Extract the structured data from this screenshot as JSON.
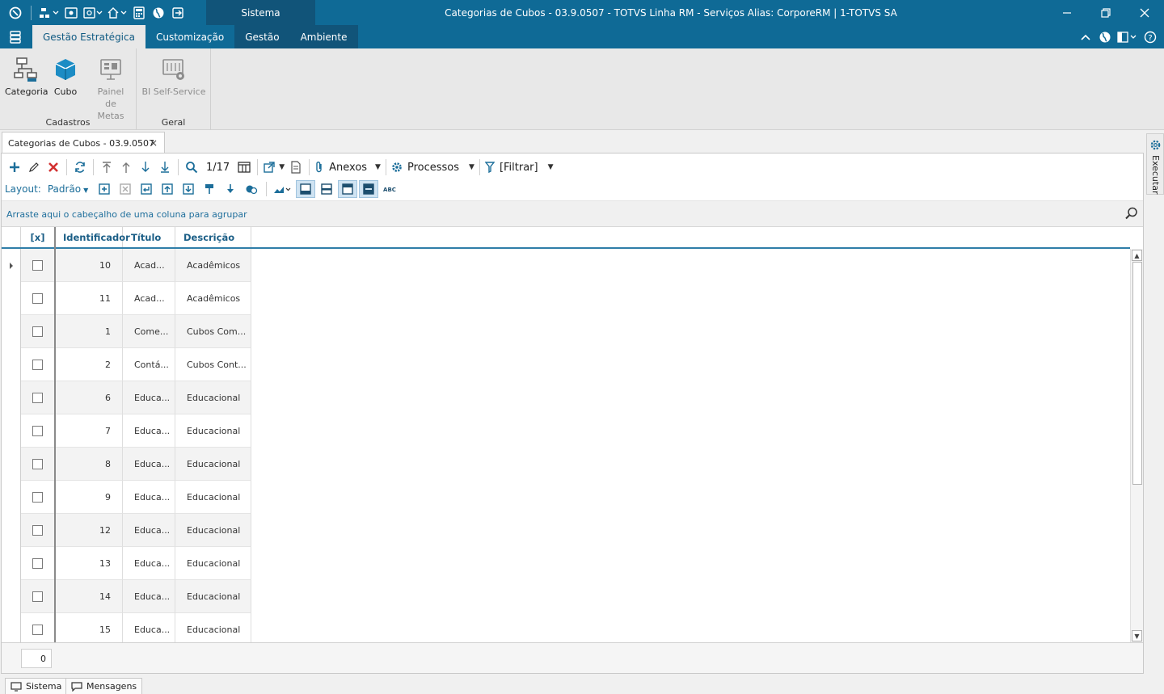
{
  "window": {
    "title": "Categorias de Cubos - 03.9.0507 - TOTVS Linha RM - Serviços  Alias: CorporeRM | 1-TOTVS SA",
    "system_tab": "Sistema"
  },
  "ribbon": {
    "tabs": [
      "Gestão Estratégica",
      "Customização",
      "Gestão",
      "Ambiente"
    ],
    "active_tab": "Gestão Estratégica",
    "groups": {
      "cadastros": {
        "label": "Cadastros",
        "buttons": {
          "categoria": "Categoria",
          "cubo": "Cubo",
          "painel_line1": "Painel",
          "painel_line2": "de Metas"
        }
      },
      "geral": {
        "label": "Geral",
        "buttons": {
          "bi": "BI Self-Service"
        }
      }
    }
  },
  "document_tab": {
    "label": "Categorias de Cubos - 03.9.0507",
    "close": "×"
  },
  "side_panel": {
    "label": "Executar"
  },
  "toolbar": {
    "record_position": "1/17",
    "anexos": "Anexos",
    "processos": "Processos",
    "filtrar": "[Filtrar]"
  },
  "layout_bar": {
    "label": "Layout:",
    "preset": "Padrão"
  },
  "group_hint": "Arraste aqui o cabeçalho de uma coluna para agrupar",
  "grid": {
    "columns": [
      "[x]",
      "Identificador",
      "Título",
      "Descrição"
    ],
    "rows": [
      {
        "id": "10",
        "titulo": "Acad...",
        "descricao": "Acadêmicos"
      },
      {
        "id": "11",
        "titulo": "Acad...",
        "descricao": "Acadêmicos"
      },
      {
        "id": "1",
        "titulo": "Come...",
        "descricao": "Cubos Com..."
      },
      {
        "id": "2",
        "titulo": "Contá...",
        "descricao": "Cubos Cont..."
      },
      {
        "id": "6",
        "titulo": "Educa...",
        "descricao": "Educacional"
      },
      {
        "id": "7",
        "titulo": "Educa...",
        "descricao": "Educacional"
      },
      {
        "id": "8",
        "titulo": "Educa...",
        "descricao": "Educacional"
      },
      {
        "id": "9",
        "titulo": "Educa...",
        "descricao": "Educacional"
      },
      {
        "id": "12",
        "titulo": "Educa...",
        "descricao": "Educacional"
      },
      {
        "id": "13",
        "titulo": "Educa...",
        "descricao": "Educacional"
      },
      {
        "id": "14",
        "titulo": "Educa...",
        "descricao": "Educacional"
      },
      {
        "id": "15",
        "titulo": "Educa...",
        "descricao": "Educacional"
      }
    ],
    "footer_count": "0"
  },
  "statusbar": {
    "sistema": "Sistema",
    "mensagens": "Mensagens"
  },
  "colors": {
    "brand": "#0f6a96",
    "brand_dark": "#115479",
    "accent_blue": "#1c6e9a",
    "danger": "#d23030"
  }
}
